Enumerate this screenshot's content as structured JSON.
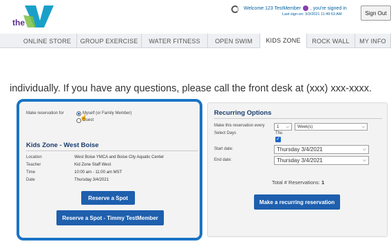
{
  "header": {
    "logo_text": "the",
    "welcome_prefix": "Welcome 123 TestMember",
    "welcome_suffix": ", you're signed in",
    "last_signon": "Last sign-on: 3/3/2021 11:49:53 AM",
    "sign_out_label": "Sign Out",
    "brand_color": "#5c2d91"
  },
  "nav": {
    "tabs": [
      {
        "label": "ONLINE STORE"
      },
      {
        "label": "GROUP EXERCISE"
      },
      {
        "label": "WATER FITNESS"
      },
      {
        "label": "OPEN SWIM"
      },
      {
        "label": "KIDS ZONE",
        "active": true
      },
      {
        "label": "ROCK WALL"
      },
      {
        "label": "MY INFO"
      }
    ]
  },
  "notice": "individually. If you have any questions, please call the front desk at (xxx) xxx-xxxx.",
  "reservation": {
    "make_for_label": "Make reservation for",
    "options": [
      {
        "label": "Myself (or Family Member)",
        "selected": true
      },
      {
        "label": "Guest",
        "selected": false
      }
    ],
    "class_title": "Kids Zone - West Boise",
    "details": [
      {
        "label": "Location",
        "value": "West Boise YMCA and Boise City Aquatic Center"
      },
      {
        "label": "Teacher",
        "value": "Kid Zone Staff West"
      },
      {
        "label": "Time",
        "value": "10:00 am - 11:00 am  MST"
      },
      {
        "label": "Date",
        "value": "Thursday 3/4/2021"
      }
    ],
    "reserve_button": "Reserve a Spot",
    "reserve_member_button": "Reserve a Spot - Timmy TestMember",
    "highlight_color": "#1a74c6",
    "button_color": "#1e5fae"
  },
  "recurring": {
    "title": "Recurring Options",
    "every_label": "Make this reservation every",
    "every_value": "1",
    "unit_value": "Week(s)",
    "select_days_label": "Select Days",
    "day_label": "Thu",
    "day_checked": true,
    "start_label": "Start date:",
    "start_value": "Thursday 3/4/2021",
    "end_label": "End date:",
    "end_value": "Thursday 3/4/2021",
    "total_label": "Total # Reservations:",
    "total_value": "1",
    "recurring_button": "Make a recurring reservation"
  }
}
